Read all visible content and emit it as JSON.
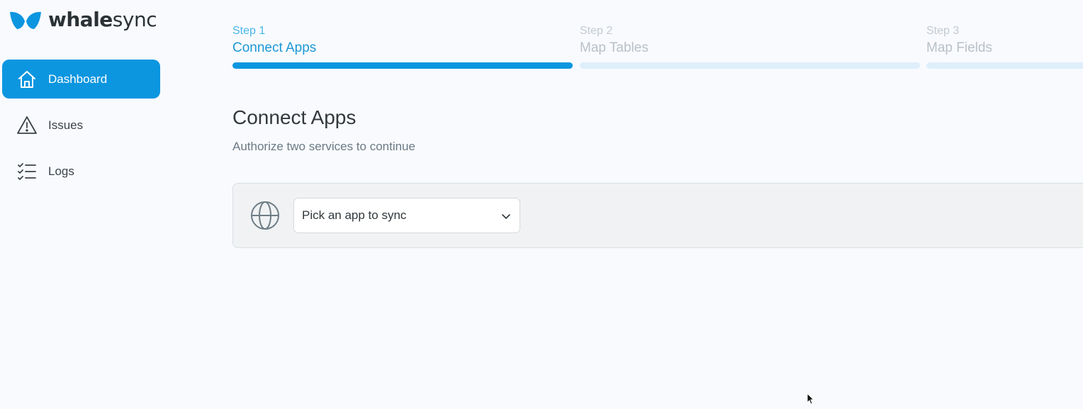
{
  "brand": {
    "name_bold": "whale",
    "name_regular": "sync",
    "logo_icon": "whale-tail-icon",
    "accent_color": "#0c96e0"
  },
  "sidebar": {
    "items": [
      {
        "label": "Dashboard",
        "icon": "home-icon",
        "active": true
      },
      {
        "label": "Issues",
        "icon": "warning-triangle-icon",
        "active": false
      },
      {
        "label": "Logs",
        "icon": "checklist-icon",
        "active": false
      }
    ]
  },
  "steps": [
    {
      "number": "Step 1",
      "title": "Connect Apps",
      "current": true
    },
    {
      "number": "Step 2",
      "title": "Map Tables",
      "current": false
    },
    {
      "number": "Step 3",
      "title": "Map Fields",
      "current": false
    }
  ],
  "main": {
    "title": "Connect Apps",
    "subtitle": "Authorize two services to continue",
    "app_picker": {
      "icon": "globe-icon",
      "selected": "Pick an app to sync",
      "dropdown_icon": "chevron-down-icon"
    }
  }
}
